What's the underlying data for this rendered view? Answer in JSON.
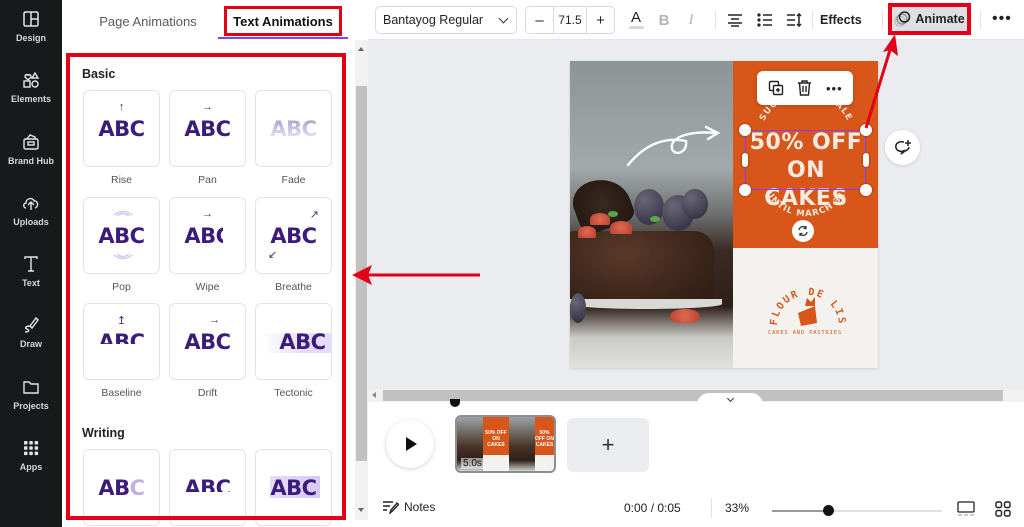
{
  "sidebar": {
    "items": [
      {
        "label": "Design",
        "icon": "layout-icon"
      },
      {
        "label": "Elements",
        "icon": "shapes-icon"
      },
      {
        "label": "Brand Hub",
        "icon": "brand-hub-icon"
      },
      {
        "label": "Uploads",
        "icon": "cloud-upload-icon"
      },
      {
        "label": "Text",
        "icon": "text-icon"
      },
      {
        "label": "Draw",
        "icon": "pen-icon"
      },
      {
        "label": "Projects",
        "icon": "folder-icon"
      },
      {
        "label": "Apps",
        "icon": "apps-grid-icon"
      }
    ]
  },
  "panel": {
    "tabs": [
      {
        "label": "Page Animations",
        "active": false
      },
      {
        "label": "Text Animations",
        "active": true
      }
    ],
    "sections": [
      {
        "title": "Basic",
        "items": [
          {
            "label": "Rise",
            "preview": "ABC",
            "arrow": "↑"
          },
          {
            "label": "Pan",
            "preview": "ABC",
            "arrow": "→"
          },
          {
            "label": "Fade",
            "preview": "ABC",
            "arrow": ""
          },
          {
            "label": "Pop",
            "preview": "ABC",
            "arrow": ""
          },
          {
            "label": "Wipe",
            "preview": "ABC",
            "arrow": "→"
          },
          {
            "label": "Breathe",
            "preview": "ABC",
            "arrow": ""
          },
          {
            "label": "Baseline",
            "preview": "ABC",
            "arrow": "↥"
          },
          {
            "label": "Drift",
            "preview": "ABC",
            "arrow": "→"
          },
          {
            "label": "Tectonic",
            "preview": "ABC",
            "arrow": ""
          }
        ]
      },
      {
        "title": "Writing",
        "items": [
          {
            "label": "",
            "preview": "ABC"
          },
          {
            "label": "",
            "preview": "ABC"
          },
          {
            "label": "",
            "preview": "ABC"
          }
        ]
      }
    ]
  },
  "toolbar": {
    "font": "Bantayog Regular",
    "size_minus": "–",
    "font_size": "71.5",
    "size_plus": "+",
    "text_color_glyph": "A",
    "bold_glyph": "B",
    "italic_glyph": "I",
    "effects_label": "Effects",
    "animate_label": "Animate",
    "more_glyph": "•••"
  },
  "canvas": {
    "headline_top": "SUGAR RUSH SALE",
    "headline_line1": "50% OFF",
    "headline_line2": "ON CAKES",
    "subline": "UNTIL MARCH 31",
    "brand_name": "FLOUR DE LIS",
    "brand_tagline": "CAKES AND PASTRIES",
    "accent_color": "#d8561a",
    "selection_color": "#8b3dff",
    "context_more": "•••"
  },
  "timeline": {
    "clip_duration": "5.0s",
    "clip_thumb_text": "50% OFF ON CAKES",
    "add_page": "+",
    "notes_label": "Notes",
    "time_readout": "0:00 / 0:05",
    "zoom_percent": "33%",
    "zoom_level": 0.33
  },
  "annotations": {
    "highlight_color": "#e30016"
  }
}
